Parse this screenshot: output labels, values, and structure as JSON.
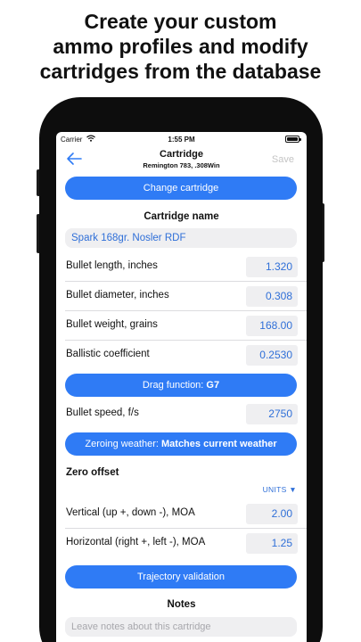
{
  "headline": {
    "line1": "Create your custom",
    "line2": "ammo profiles and modify",
    "line3": "cartridges from the database"
  },
  "status_bar": {
    "carrier": "Carrier",
    "time": "1:55 PM"
  },
  "nav": {
    "title": "Cartridge",
    "subtitle": "Remington 783, .308Win",
    "save_label": "Save"
  },
  "change_cartridge_label": "Change cartridge",
  "cartridge_name": {
    "title": "Cartridge name",
    "value": "Spark 168gr. Nosler RDF"
  },
  "fields": [
    {
      "label": "Bullet length, inches",
      "value": "1.320"
    },
    {
      "label": "Bullet diameter, inches",
      "value": "0.308"
    },
    {
      "label": "Bullet weight, grains",
      "value": "168.00"
    },
    {
      "label": "Ballistic coefficient",
      "value": "0.2530"
    }
  ],
  "drag_function": {
    "prefix": "Drag function: ",
    "value": "G7"
  },
  "bullet_speed": {
    "label": "Bullet speed, f/s",
    "value": "2750"
  },
  "zeroing_weather": {
    "prefix": "Zeroing weather: ",
    "value": "Matches current weather"
  },
  "zero_offset": {
    "title": "Zero offset",
    "units_label": "UNITS",
    "units_icon": "triangle-down",
    "vertical": {
      "label": "Vertical (up +, down -), MOA",
      "value": "2.00"
    },
    "horizontal": {
      "label": "Horizontal (right +, left -), MOA",
      "value": "1.25"
    }
  },
  "trajectory_validation_label": "Trajectory validation",
  "notes": {
    "title": "Notes",
    "placeholder": "Leave notes about this cartridge"
  },
  "colors": {
    "accent": "#2f7bf5",
    "value_text": "#2f6fd8",
    "field_bg": "#efeff1",
    "phone_frame": "#0d0d0d"
  }
}
